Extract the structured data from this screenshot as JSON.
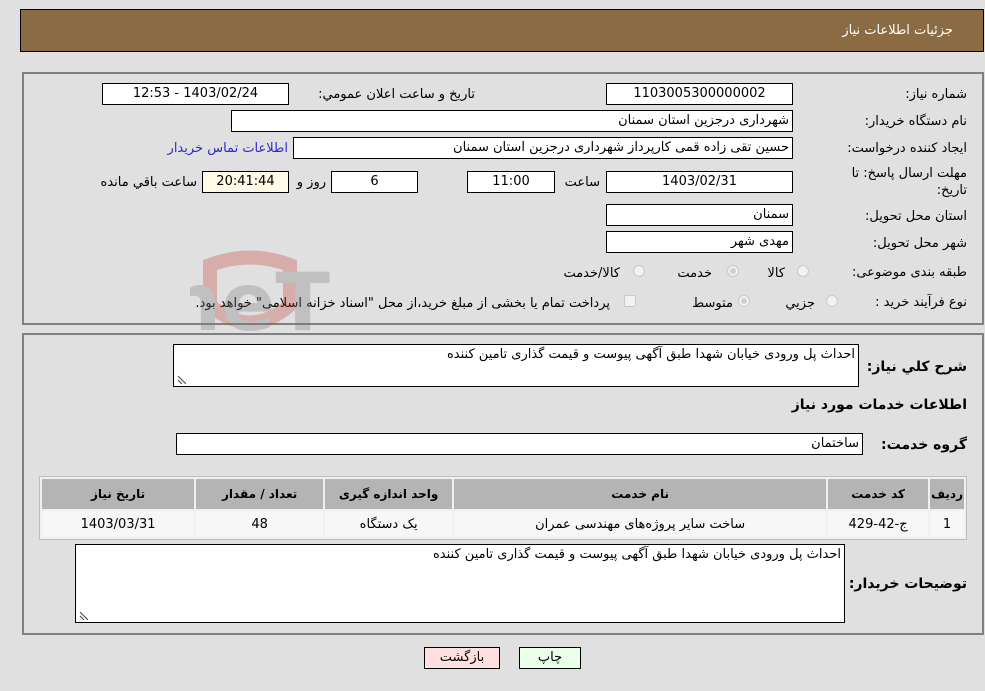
{
  "header": {
    "title": "جزئيات اطلاعات نياز"
  },
  "form": {
    "need_number": {
      "label": "شماره نياز:",
      "value": "1103005300000002"
    },
    "announce_datetime": {
      "label": "تاريخ و ساعت اعلان عمومي:",
      "value": "1403/02/24 - 12:53"
    },
    "buyer_org": {
      "label": "نام دستگاه خريدار:",
      "value": "شهرداری درجزین استان سمنان"
    },
    "requester": {
      "label": "ايجاد كننده درخواست:",
      "value": "حسین تقی زاده قمی کارپرداز شهرداری درجزین استان سمنان"
    },
    "buyer_contact_link": "اطلاعات تماس خريدار",
    "deadline": {
      "label": "مهلت ارسال پاسخ: تا تاريخ:",
      "date": "1403/02/31",
      "time_label": "ساعت",
      "time": "11:00",
      "days": "6",
      "days_label": "روز و",
      "remaining": "20:41:44",
      "remaining_label": "ساعت باقي مانده"
    },
    "delivery_province": {
      "label": "استان محل تحويل:",
      "value": "سمنان"
    },
    "delivery_city": {
      "label": "شهر محل تحويل:",
      "value": "مهدی شهر"
    },
    "category": {
      "label": "طبقه بندی موضوعی:",
      "options": [
        "کالا",
        "خدمت",
        "کالا/خدمت"
      ],
      "selected": "خدمت"
    },
    "purchase_type": {
      "label": "نوع فرآيند خريد :",
      "options": [
        "جزيي",
        "متوسط"
      ],
      "selected": "متوسط",
      "treasury_checkbox_label": "پرداخت تمام يا بخشی از مبلغ خريد،از محل \"اسناد خزانه اسلامی\" خواهد بود.",
      "treasury_checked": false
    }
  },
  "details": {
    "summary_label": "شرح كلي نياز:",
    "summary_value": "احداث پل ورودی خیابان شهدا طبق آگهی پیوست و قیمت گذاری تامین کننده",
    "services_heading": "اطلاعات خدمات مورد نياز",
    "service_group_label": "گروه خدمت:",
    "service_group_value": "ساختمان",
    "table": {
      "headers": [
        "رديف",
        "كد خدمت",
        "نام خدمت",
        "واحد اندازه گيری",
        "تعداد / مقدار",
        "تاريخ نياز"
      ],
      "rows": [
        [
          "1",
          "ج-42-429",
          "ساخت سایر پروژه‌های مهندسی عمران",
          "یک دستگاه",
          "48",
          "1403/03/31"
        ]
      ]
    },
    "buyer_notes_label": "توضيحات خريدار:",
    "buyer_notes_value": "احداث پل ورودی خیابان شهدا طبق آگهی پیوست و قیمت گذاری تامین کننده"
  },
  "buttons": {
    "print": "چاپ",
    "back": "بازگشت"
  },
  "watermark": {
    "text": "AriaTender.neT"
  }
}
